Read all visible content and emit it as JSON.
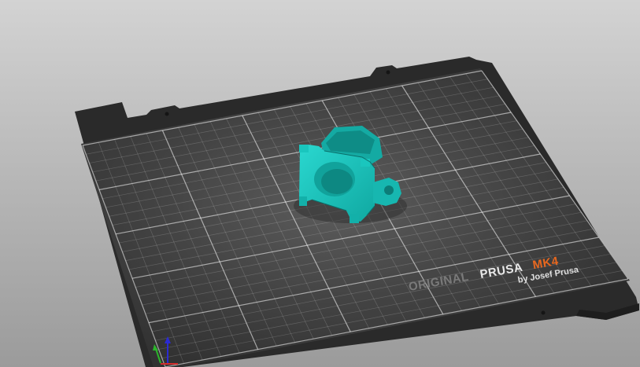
{
  "viewport": {
    "background_top": "#d3d3d3",
    "background_bottom": "#9b9b9b"
  },
  "bed": {
    "frame_color": "#2b2b2b",
    "surface_color": "#3c3c3c",
    "grid_color": "#ffffff",
    "brand_original": "ORIGINAL",
    "brand_prusa": "PRUSA",
    "brand_model": "MK4",
    "brand_tagline": "by Josef Prusa",
    "brand_model_color": "#e8671e"
  },
  "model": {
    "name": "printed-part",
    "color": "#19c2bb",
    "shade_color": "#0f8f8a"
  },
  "axes": {
    "x_color": "#d22b2b",
    "y_color": "#2bb52b",
    "z_color": "#2b2bd2"
  }
}
